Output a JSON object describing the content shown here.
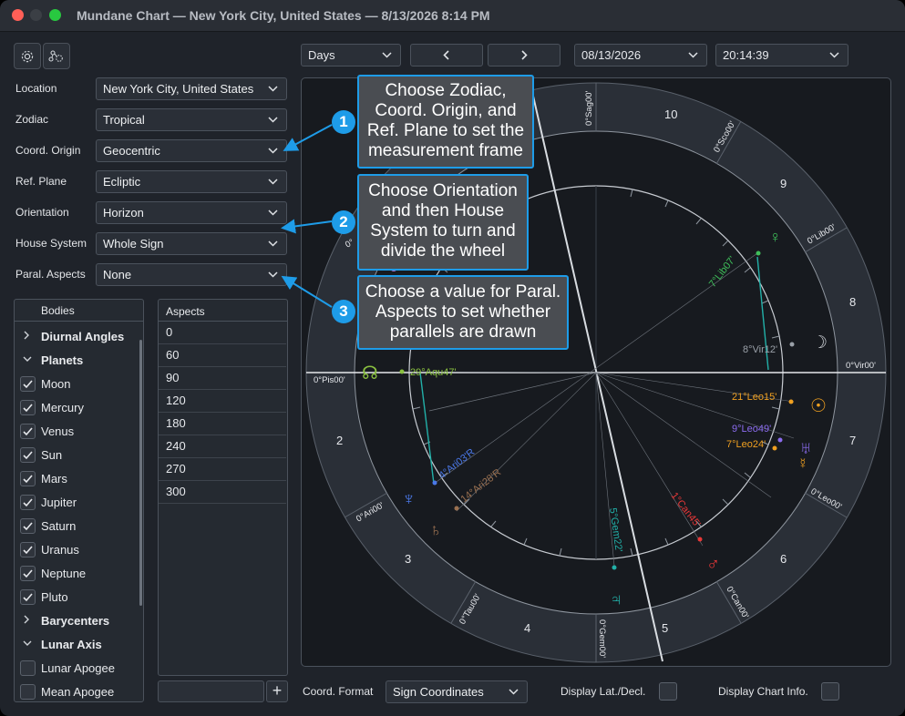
{
  "window": {
    "title": "Mundane Chart — New York City, United States — 8/13/2026 8:14 PM"
  },
  "settings": [
    {
      "label": "Location",
      "value": "New York City, United States"
    },
    {
      "label": "Zodiac",
      "value": "Tropical"
    },
    {
      "label": "Coord. Origin",
      "value": "Geocentric"
    },
    {
      "label": "Ref. Plane",
      "value": "Ecliptic"
    },
    {
      "label": "Orientation",
      "value": "Horizon"
    },
    {
      "label": "House System",
      "value": "Whole Sign"
    },
    {
      "label": "Paral. Aspects",
      "value": "None"
    }
  ],
  "bodies": {
    "header": "Bodies",
    "groups": [
      {
        "label": "Diurnal Angles",
        "expanded": false
      },
      {
        "label": "Planets",
        "expanded": true
      },
      {
        "label": "Barycenters",
        "expanded": false
      },
      {
        "label": "Lunar Axis",
        "expanded": true
      }
    ],
    "planets": [
      {
        "label": "Moon",
        "checked": true
      },
      {
        "label": "Mercury",
        "checked": true
      },
      {
        "label": "Venus",
        "checked": true
      },
      {
        "label": "Sun",
        "checked": true
      },
      {
        "label": "Mars",
        "checked": true
      },
      {
        "label": "Jupiter",
        "checked": true
      },
      {
        "label": "Saturn",
        "checked": true
      },
      {
        "label": "Uranus",
        "checked": true
      },
      {
        "label": "Neptune",
        "checked": true
      },
      {
        "label": "Pluto",
        "checked": true
      }
    ],
    "lunar": [
      {
        "label": "Lunar Apogee",
        "checked": false
      },
      {
        "label": "Mean Apogee",
        "checked": false
      }
    ]
  },
  "aspects": {
    "header": "Aspects",
    "values": [
      "0",
      "60",
      "90",
      "120",
      "180",
      "240",
      "270",
      "300"
    ],
    "add_label": "+"
  },
  "toolbar": {
    "step": "Days",
    "prev": "‹",
    "next": "›",
    "date": "08/13/2026",
    "time": "20:14:39"
  },
  "chart": {
    "houses": [
      "10",
      "9",
      "8",
      "7",
      "6",
      "5",
      "4",
      "3",
      "2"
    ],
    "sign_cusps": [
      "0°Sag00'",
      "0°Sco00'",
      "0°Lib00'",
      "0°Vir00'",
      "0°Leo00'",
      "0°Can00'",
      "0°Gem00'",
      "0°Tau00'",
      "0°Ari00'",
      "0°Pis00'",
      "0°"
    ],
    "planets": [
      {
        "label": "7°Lib07'",
        "glyph": "♀",
        "color": "#3fbf5a"
      },
      {
        "label": "8°Vir12'",
        "glyph": "☽",
        "color": "#9aa0a8"
      },
      {
        "label": "21°Leo15'",
        "glyph": "☉",
        "color": "#f0a020"
      },
      {
        "label": "9°Leo49'",
        "glyph": "♅",
        "color": "#8c6cf0"
      },
      {
        "label": "7°Leo24'",
        "glyph": "☿",
        "color": "#f0a020"
      },
      {
        "label": "1°Can45'",
        "glyph": "♂",
        "color": "#e83838"
      },
      {
        "label": "5°Gem22'",
        "glyph": "♃",
        "color": "#22b0a8"
      },
      {
        "label": "14°Ari28'R",
        "glyph": "♄",
        "color": "#9a7050"
      },
      {
        "label": "4°Ari03'R",
        "glyph": "♆",
        "color": "#4a78e8"
      },
      {
        "label": "29°Aqu47'",
        "glyph": "☊",
        "color": "#8ac040"
      }
    ]
  },
  "callouts": [
    {
      "num": "1",
      "text": "Choose Zodiac, Coord. Origin, and Ref. Plane to set the measurement frame"
    },
    {
      "num": "2",
      "text": "Choose Orientation and then House System to turn and divide the wheel"
    },
    {
      "num": "3",
      "text": "Choose a value for Paral. Aspects to set whether parallels are drawn"
    }
  ],
  "footer": {
    "coord_format_label": "Coord. Format",
    "coord_format_value": "Sign Coordinates",
    "display_lat_label": "Display Lat./Decl.",
    "display_info_label": "Display Chart Info."
  }
}
